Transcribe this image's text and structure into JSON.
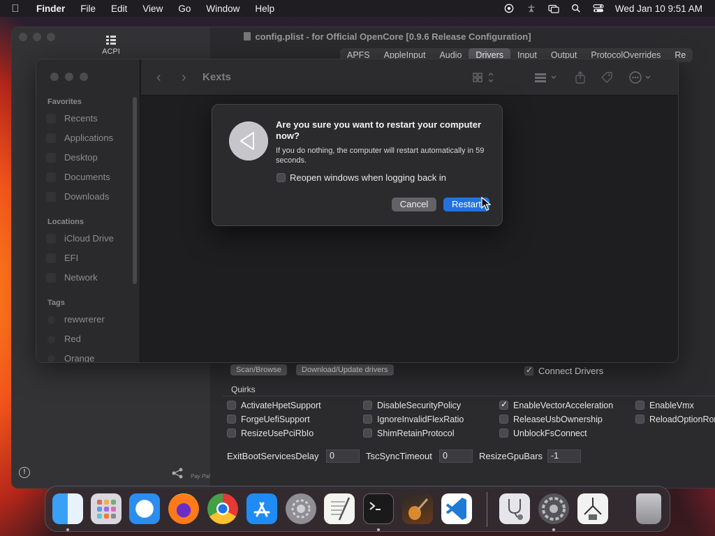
{
  "menubar": {
    "app": "Finder",
    "items": [
      "File",
      "Edit",
      "View",
      "Go",
      "Window",
      "Help"
    ],
    "clock": "Wed Jan 10  9:51 AM"
  },
  "oc": {
    "title": "config.plist - for Official OpenCore [0.9.6 Release Configuration]",
    "sidebar_top_label": "ACPI",
    "paypal": "Pay Pal",
    "tabs": [
      "APFS",
      "AppleInput",
      "Audio",
      "Drivers",
      "Input",
      "Output",
      "ProtocolOverrides",
      "Re"
    ],
    "active_tab": "Drivers",
    "scan_button": "Scan/Browse",
    "download_button": "Download/Update drivers",
    "connect_drivers": "Connect Drivers",
    "quirks_label": "Quirks",
    "quirks": [
      {
        "label": "ActivateHpetSupport",
        "checked": false
      },
      {
        "label": "ForgeUefiSupport",
        "checked": false
      },
      {
        "label": "ResizeUsePciRbIo",
        "checked": false
      },
      {
        "label": "DisableSecurityPolicy",
        "checked": false
      },
      {
        "label": "IgnoreInvalidFlexRatio",
        "checked": false
      },
      {
        "label": "ShimRetainProtocol",
        "checked": false
      },
      {
        "label": "EnableVectorAcceleration",
        "checked": true
      },
      {
        "label": "ReleaseUsbOwnership",
        "checked": false
      },
      {
        "label": "UnblockFsConnect",
        "checked": false
      },
      {
        "label": "EnableVmx",
        "checked": false
      },
      {
        "label": "ReloadOptionRon",
        "checked": false
      }
    ],
    "fields": {
      "exit_label": "ExitBootServicesDelay",
      "exit_value": "0",
      "tsc_label": "TscSyncTimeout",
      "tsc_value": "0",
      "resize_label": "ResizeGpuBars",
      "resize_value": "-1"
    }
  },
  "finder": {
    "title": "Kexts",
    "favorites_label": "Favorites",
    "favorites": [
      "Recents",
      "Applications",
      "Desktop",
      "Documents",
      "Downloads"
    ],
    "locations_label": "Locations",
    "locations": [
      "iCloud Drive",
      "EFI",
      "Network"
    ],
    "tags_label": "Tags",
    "tags": [
      "rewwrerer",
      "Red",
      "Orange"
    ]
  },
  "dialog": {
    "title": "Are you sure you want to restart your computer now?",
    "message": "If you do nothing, the computer will restart automatically in 59 seconds.",
    "checkbox_label": "Reopen windows when logging back in",
    "checkbox_checked": false,
    "cancel": "Cancel",
    "restart": "Restart"
  },
  "dock": {
    "apps": [
      "finder-icon",
      "launchpad-icon",
      "safari-icon",
      "firefox-icon",
      "chrome-icon",
      "app-store-icon",
      "system-settings-icon",
      "textedit-icon",
      "terminal-icon",
      "garageband-icon",
      "vscode-icon",
      "disk-utility-icon",
      "opencore-configurator-icon",
      "propertree-icon",
      "trash-icon"
    ]
  }
}
